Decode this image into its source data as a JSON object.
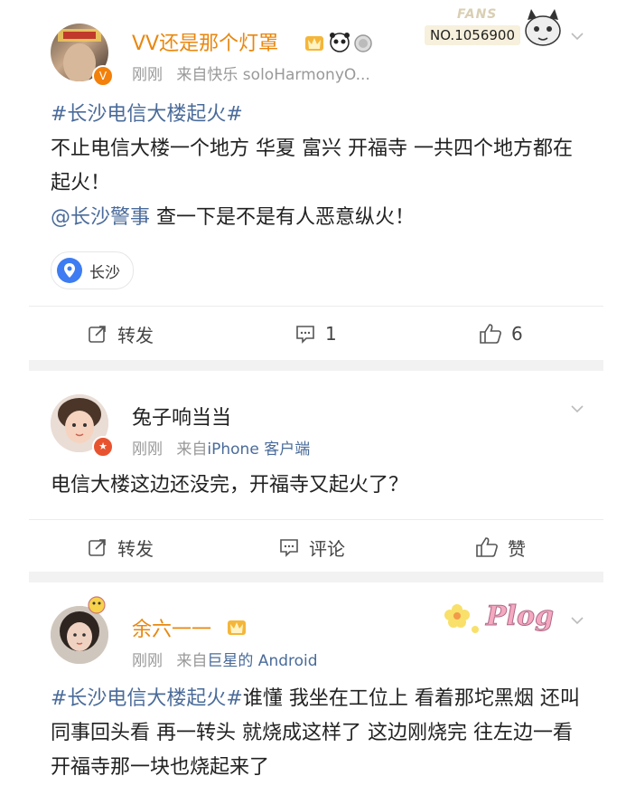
{
  "post1": {
    "username": "VV还是那个灯罩",
    "time": "刚刚",
    "from_label": "来自",
    "source": "快乐 soloHarmonyO...",
    "fans_label": "FANS",
    "fans_no": "NO.1056900",
    "hashtag": "#长沙电信大楼起火#",
    "text1": "不止电信大楼一个地方 华夏 富兴 开福寺 一共四个地方都在起火！",
    "mention": "@长沙警事",
    "text2": " 查一下是不是有人恶意纵火！",
    "location": "长沙",
    "repost_label": "转发",
    "comment_count": "1",
    "like_count": "6"
  },
  "post2": {
    "username": "兔子响当当",
    "time": "刚刚",
    "from_label": "来自",
    "source": "iPhone 客户端",
    "text": "电信大楼这边还没完，开福寺又起火了？",
    "repost_label": "转发",
    "comment_label": "评论",
    "like_label": "赞"
  },
  "post3": {
    "username": "余六一一",
    "time": "刚刚",
    "from_label": "来自",
    "source": "巨星",
    "source_suffix": "的 Android",
    "sticker_text": "Plog",
    "hashtag": "#长沙电信大楼起火#",
    "text": "谁懂 我坐在工位上 看着那坨黑烟 还叫同事回头看 再一转头 就烧成这样了 这边刚烧完 往左边一看 开福寺那一块也烧起来了"
  },
  "colors": {
    "link": "#4a6b9a",
    "orange_name": "#e8870f",
    "meta": "#999999",
    "separator": "#f2f2f2"
  }
}
